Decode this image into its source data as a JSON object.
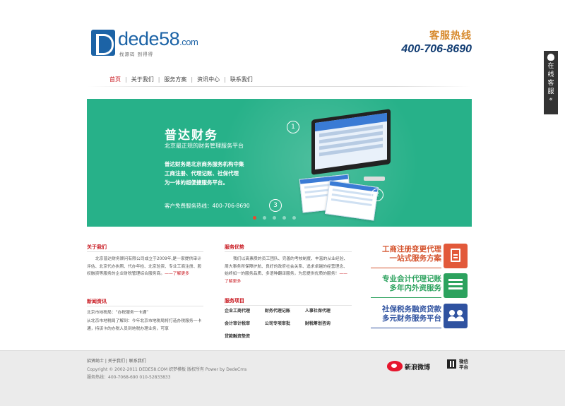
{
  "header": {
    "logo_main": "dede58",
    "logo_suffix": ".com",
    "logo_slogan": "找源码 到得得",
    "hotline_label": "客服热线",
    "hotline_number": "400-706-8690"
  },
  "nav": {
    "items": [
      "首页",
      "关于我们",
      "服务方案",
      "资讯中心",
      "联系我们"
    ],
    "active_index": 0
  },
  "banner": {
    "title": "普达财务",
    "subtitle": "北京最正规的财务管理服务平台",
    "desc_line1": "普达财务是北京商务服务机构中集",
    "desc_line2": "工商注册、代理记账、社保代理",
    "desc_line3": "为一体的超便捷服务平台。",
    "phone": "客户免费服务热线：400-706-8690",
    "circle_labels": [
      "1",
      "2",
      "3"
    ],
    "slides_total": 5,
    "active_slide": 0,
    "bg_color": "#27b189"
  },
  "side_service": {
    "label_chars": [
      "在",
      "线",
      "客",
      "服"
    ],
    "toggle": "«"
  },
  "about": {
    "title": "关于我们",
    "text": "北京普达财务顾问有限公司成立于2009年,是一家提供审计评估、北京代办执照、代办年检、北京验资、专业工商注册、股权融资等服务的企业财税管理综合服务商。",
    "more": "——了解更多"
  },
  "news": {
    "title": "新闻资讯",
    "line1": "北京市地税局：“办税服务一卡通”",
    "line2": "从北京市地税局了解到：今年北京市地税局将打造办税服务一卡通，持该卡的办税人员到地税办理业务，可享"
  },
  "advantage": {
    "title": "服务优势",
    "text": "我们以高素质的员工团队、完善的考核制度、丰富的从业经验、周大事务所保障护航、良好的政府社会关系、追求卓越的经营理念、始终如一的服务品质、多语种翻译服务，为您提供优质的服务！",
    "more": "——了解更多"
  },
  "services": {
    "title": "服务项目",
    "items": [
      "企业工商代理",
      "财务代理记账",
      "人事社保代理",
      "会计审计税审",
      "公司专项审批",
      "财税筹划咨询",
      "贷款融资垫资"
    ]
  },
  "promos": [
    {
      "line1": "工商注册变更代理",
      "line2": "一站式服务方案",
      "icon": "document-icon",
      "color": "#e2593a"
    },
    {
      "line1": "专业会计代理记账",
      "line2": "多年内外资服务",
      "icon": "list-icon",
      "color": "#2ca25e"
    },
    {
      "line1": "社保税务融资贷款",
      "line2": "多元财务服务平台",
      "icon": "users-icon",
      "color": "#2f52a0"
    }
  ],
  "footer": {
    "links": [
      "招贤纳士",
      "关于我们",
      "联系我们"
    ],
    "copyright": "Copyright © 2002-2011 DEDE58.COM 织梦模板 版权所有 Power by DedeCms",
    "phone": "服务热线：400-7068-690 010-52833833",
    "weibo": "新浪微博",
    "wechat": "微信平台"
  }
}
